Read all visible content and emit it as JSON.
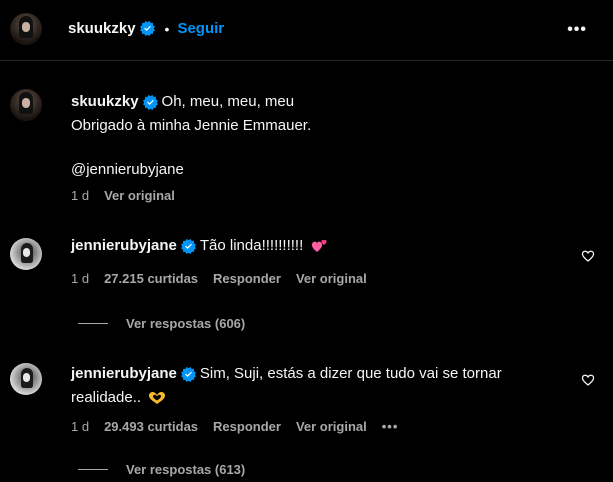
{
  "header": {
    "username": "skuukzky",
    "separator": "•",
    "follow_label": "Seguir",
    "more_label": "•••"
  },
  "caption": {
    "username": "skuukzky",
    "line1": "Oh, meu, meu, meu",
    "line2": "Obrigado à minha Jennie Emmauer.",
    "line3": "@jennierubyjane",
    "time": "1 d",
    "translate_label": "Ver original"
  },
  "comments": [
    {
      "username": "jennierubyjane",
      "text": "Tão linda!!!!!!!!!!",
      "emoji_icon": "two-hearts-icon",
      "time": "1 d",
      "likes": "27.215 curtidas",
      "reply_label": "Responder",
      "translate_label": "Ver original",
      "view_replies": "Ver respostas (606)"
    },
    {
      "username": "jennierubyjane",
      "text_line1": "Sim, Suji, estás a dizer que tudo vai se tornar",
      "text_line2": "realidade..",
      "emoji_icon": "heart-hands-icon",
      "time": "1 d",
      "likes": "29.493 curtidas",
      "reply_label": "Responder",
      "translate_label": "Ver original",
      "more_label": "•••",
      "view_replies": "Ver respostas (613)"
    }
  ],
  "colors": {
    "background": "#000000",
    "text": "#f5f5f5",
    "muted": "#a8a8a8",
    "link": "#0095f6",
    "verified": "#0095f6"
  }
}
